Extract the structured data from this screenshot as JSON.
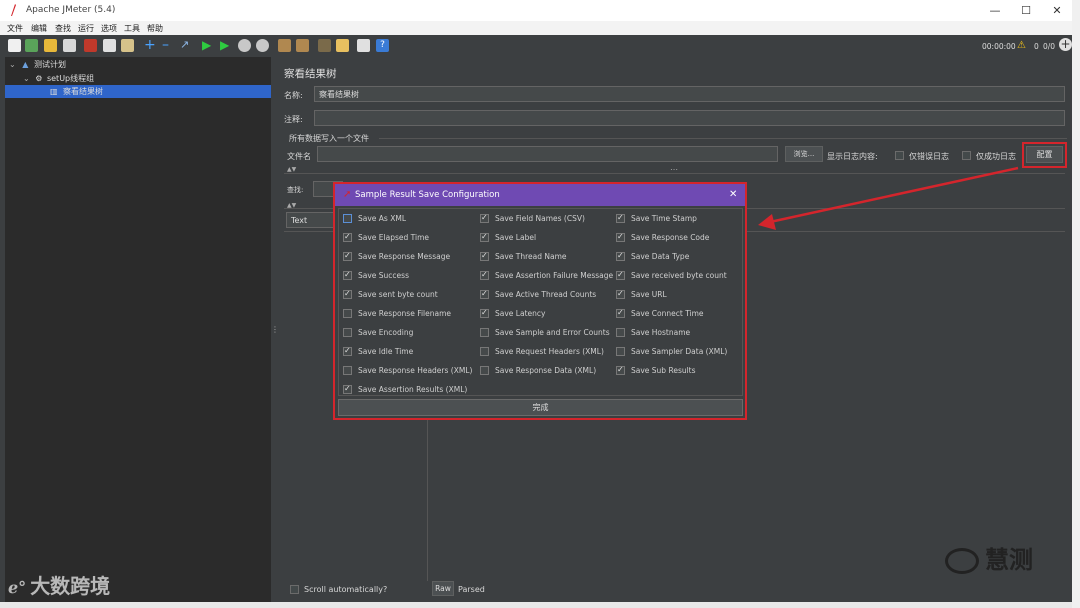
{
  "window": {
    "title": "Apache JMeter (5.4)"
  },
  "menu": [
    "文件",
    "编辑",
    "查找",
    "运行",
    "选项",
    "工具",
    "帮助"
  ],
  "toolbar": {
    "timer": "00:00:00",
    "warn_count": "0",
    "threads": "0/0"
  },
  "tree": {
    "items": [
      {
        "label": "测试计划"
      },
      {
        "label": "setUp线程组"
      },
      {
        "label": "察看结果树"
      }
    ]
  },
  "panel": {
    "title": "察看结果树",
    "name_label": "名称:",
    "name_value": "察看结果树",
    "comment_label": "注释:",
    "file_group_label": "所有数据写入一个文件",
    "filename_label": "文件名",
    "browse_label": "浏览...",
    "log_content_label": "显示日志内容:",
    "errors_only_label": "仅错误日志",
    "success_only_label": "仅成功日志",
    "config_label": "配置",
    "search_label": "查找:",
    "text_dropdown": "Text",
    "scroll_label": "Scroll automatically?",
    "tab_raw": "Raw",
    "tab_parsed": "Parsed"
  },
  "dialog": {
    "title": "Sample Result Save Configuration",
    "options": [
      {
        "label": "Save As XML",
        "checked": false
      },
      {
        "label": "Save Field Names (CSV)",
        "checked": true
      },
      {
        "label": "Save Time Stamp",
        "checked": true
      },
      {
        "label": "Save Elapsed Time",
        "checked": true
      },
      {
        "label": "Save Label",
        "checked": true
      },
      {
        "label": "Save Response Code",
        "checked": true
      },
      {
        "label": "Save Response Message",
        "checked": true
      },
      {
        "label": "Save Thread Name",
        "checked": true
      },
      {
        "label": "Save Data Type",
        "checked": true
      },
      {
        "label": "Save Success",
        "checked": true
      },
      {
        "label": "Save Assertion Failure Message",
        "checked": true
      },
      {
        "label": "Save received byte count",
        "checked": true
      },
      {
        "label": "Save sent byte count",
        "checked": true
      },
      {
        "label": "Save Active Thread Counts",
        "checked": true
      },
      {
        "label": "Save URL",
        "checked": true
      },
      {
        "label": "Save Response Filename",
        "checked": false
      },
      {
        "label": "Save Latency",
        "checked": true
      },
      {
        "label": "Save Connect Time",
        "checked": true
      },
      {
        "label": "Save Encoding",
        "checked": false
      },
      {
        "label": "Save Sample and Error Counts",
        "checked": false
      },
      {
        "label": "Save Hostname",
        "checked": false
      },
      {
        "label": "Save Idle Time",
        "checked": true
      },
      {
        "label": "Save Request Headers (XML)",
        "checked": false
      },
      {
        "label": "Save Sampler Data (XML)",
        "checked": false
      },
      {
        "label": "Save Response Headers (XML)",
        "checked": false
      },
      {
        "label": "Save Response Data (XML)",
        "checked": false
      },
      {
        "label": "Save Sub Results",
        "checked": true
      },
      {
        "label": "Save Assertion Results (XML)",
        "checked": true
      }
    ],
    "done_label": "完成"
  },
  "watermark": {
    "brand": "慧测",
    "bottom": "大数跨境"
  },
  "colors": {
    "accent_purple": "#6f4ab3",
    "highlight_red": "#d4252c",
    "bg_dark": "#3c3f41"
  }
}
